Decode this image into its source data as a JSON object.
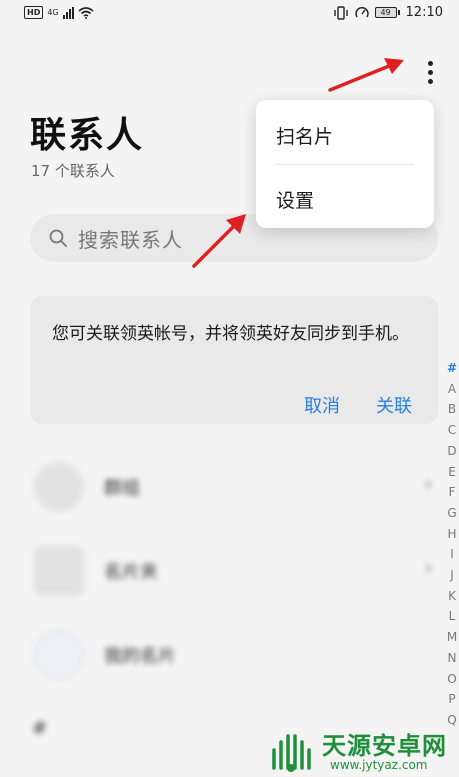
{
  "status_bar": {
    "hd_badge": "HD",
    "network": "4G",
    "battery_level": "49",
    "time": "12:10"
  },
  "header": {
    "title": "联系人",
    "contact_count": "17 个联系人",
    "more_icon": "more-vertical-icon"
  },
  "popup_menu": {
    "items": [
      {
        "label": "扫名片"
      },
      {
        "label": "设置"
      }
    ]
  },
  "search": {
    "placeholder": "搜索联系人",
    "icon": "search-icon"
  },
  "banner": {
    "message": "您可关联领英帐号，并将领英好友同步到手机。",
    "cancel_label": "取消",
    "link_label": "关联"
  },
  "contact_rows": [
    {
      "label": "群组",
      "has_chevron": true
    },
    {
      "label": "名片夹",
      "has_chevron": true
    },
    {
      "label": "我的名片",
      "has_chevron": false
    }
  ],
  "section_header": "#",
  "index_letters": [
    "#",
    "A",
    "B",
    "C",
    "D",
    "E",
    "F",
    "G",
    "H",
    "I",
    "J",
    "K",
    "L",
    "M",
    "N",
    "O",
    "P",
    "Q"
  ],
  "index_active": "#",
  "colors": {
    "accent": "#2a7fde",
    "annotation_arrow": "#e02020",
    "watermark_green": "#1f8f3a"
  },
  "watermark": {
    "title": "天源安卓网",
    "url": "www.jytyaz.com"
  }
}
